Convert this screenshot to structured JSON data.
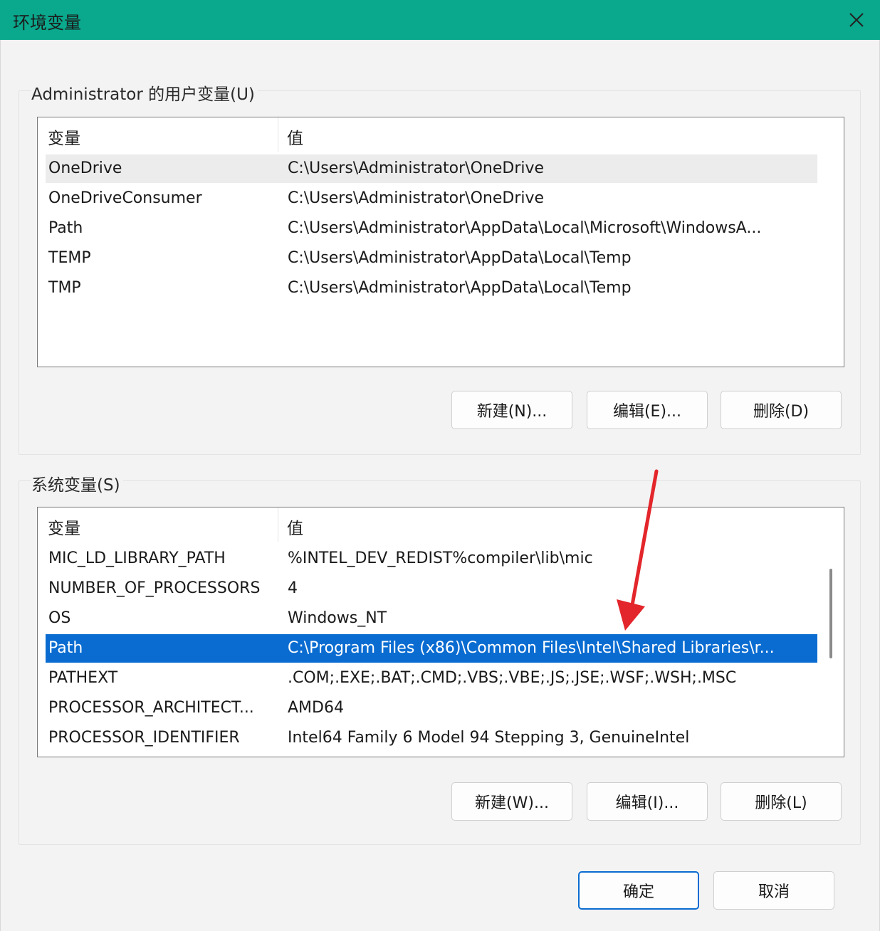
{
  "window": {
    "title": "环境变量"
  },
  "user_vars": {
    "legend": "Administrator 的用户变量(U)",
    "header": {
      "name": "变量",
      "value": "值"
    },
    "rows": [
      {
        "name": "OneDrive",
        "value": "C:\\Users\\Administrator\\OneDrive"
      },
      {
        "name": "OneDriveConsumer",
        "value": "C:\\Users\\Administrator\\OneDrive"
      },
      {
        "name": "Path",
        "value": "C:\\Users\\Administrator\\AppData\\Local\\Microsoft\\WindowsA..."
      },
      {
        "name": "TEMP",
        "value": "C:\\Users\\Administrator\\AppData\\Local\\Temp"
      },
      {
        "name": "TMP",
        "value": "C:\\Users\\Administrator\\AppData\\Local\\Temp"
      }
    ],
    "buttons": {
      "new": "新建(N)...",
      "edit": "编辑(E)...",
      "delete": "删除(D)"
    }
  },
  "system_vars": {
    "legend": "系统变量(S)",
    "header": {
      "name": "变量",
      "value": "值"
    },
    "rows": [
      {
        "name": "MIC_LD_LIBRARY_PATH",
        "value": "%INTEL_DEV_REDIST%compiler\\lib\\mic"
      },
      {
        "name": "NUMBER_OF_PROCESSORS",
        "value": "4"
      },
      {
        "name": "OS",
        "value": "Windows_NT"
      },
      {
        "name": "Path",
        "value": "C:\\Program Files (x86)\\Common Files\\Intel\\Shared Libraries\\r..."
      },
      {
        "name": "PATHEXT",
        "value": ".COM;.EXE;.BAT;.CMD;.VBS;.VBE;.JS;.JSE;.WSF;.WSH;.MSC"
      },
      {
        "name": "PROCESSOR_ARCHITECT...",
        "value": "AMD64"
      },
      {
        "name": "PROCESSOR_IDENTIFIER",
        "value": "Intel64 Family 6 Model 94 Stepping 3, GenuineIntel"
      }
    ],
    "selected_row": "Path",
    "buttons": {
      "new": "新建(W)...",
      "edit": "编辑(I)...",
      "delete": "删除(L)"
    }
  },
  "footer": {
    "ok": "确定",
    "cancel": "取消"
  },
  "colors": {
    "titlebar": "#0aa88c",
    "selection": "#0a6cd1",
    "annotation_arrow": "#e3262b"
  },
  "icons": {
    "close": "close-icon",
    "arrow": "red-arrow-annotation"
  }
}
